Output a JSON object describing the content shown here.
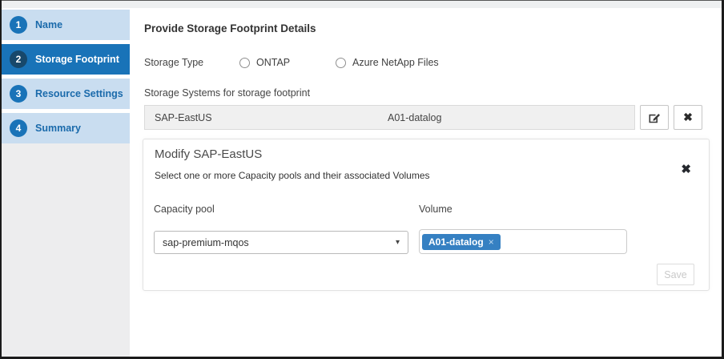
{
  "wizard": {
    "steps": [
      {
        "number": "1",
        "label": "Name",
        "active": false
      },
      {
        "number": "2",
        "label": "Storage Footprint",
        "active": true
      },
      {
        "number": "3",
        "label": "Resource Settings",
        "active": false
      },
      {
        "number": "4",
        "label": "Summary",
        "active": false
      }
    ]
  },
  "main": {
    "title": "Provide Storage Footprint Details",
    "storage_type": {
      "label": "Storage Type",
      "options": [
        {
          "label": "ONTAP",
          "checked": false
        },
        {
          "label": "Azure NetApp Files",
          "checked": false
        }
      ]
    },
    "storage_systems": {
      "label": "Storage Systems for storage footprint",
      "rows": [
        {
          "system": "SAP-EastUS",
          "volume": "A01-datalog"
        }
      ],
      "edit_icon": "pencil-square",
      "remove_glyph": "✖"
    }
  },
  "modal": {
    "title": "Modify SAP-EastUS",
    "subtitle": "Select one or more Capacity pools and their associated Volumes",
    "close_glyph": "✖",
    "capacity_pool": {
      "label": "Capacity pool",
      "selected": "sap-premium-mqos",
      "caret_glyph": "▾"
    },
    "volume": {
      "label": "Volume",
      "chips": [
        {
          "text": "A01-datalog",
          "remove_glyph": "×"
        }
      ]
    },
    "save_label": "Save"
  },
  "colors": {
    "accent_blue": "#1973b8",
    "step_inactive_bg": "#c9ddf0",
    "active_circle": "#17486b",
    "chip_blue": "#3580c2",
    "row_gray": "#f0f0f0",
    "disabled_text": "#c9c9c9"
  }
}
